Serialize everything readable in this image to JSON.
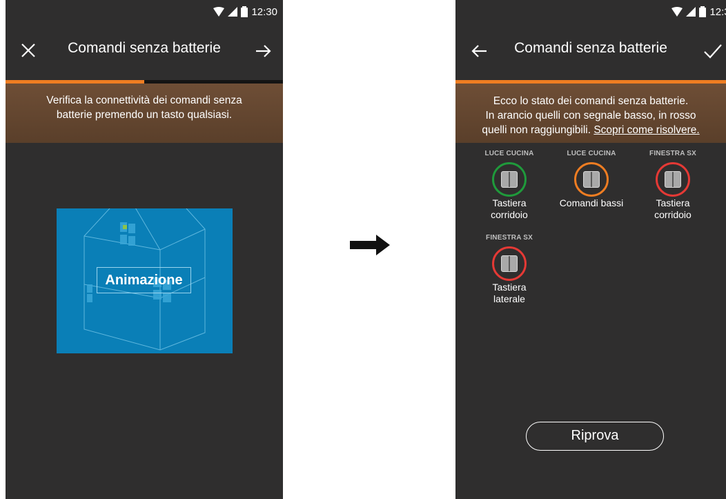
{
  "status_bar": {
    "time": "12:30"
  },
  "left_screen": {
    "title": "Comandi senza batterie",
    "progress_fraction": 0.5,
    "banner_lines": [
      "Verifica la connettività dei comandi senza",
      "batterie premendo un tasto qualsiasi."
    ],
    "animation_label": "Animazione",
    "icons": {
      "left": "close-icon",
      "right": "arrow-right-icon"
    }
  },
  "right_screen": {
    "title": "Comandi senza batterie",
    "banner_lines": [
      "Ecco lo stato dei comandi senza batterie.",
      "In arancio quelli con segnale basso, in rosso"
    ],
    "banner_last_prefix": "quelli non raggiungibili. ",
    "banner_link": "Scopri come risolvere.",
    "devices": [
      {
        "caption": "LUCE CUCINA",
        "name_line1": "Tastiera",
        "name_line2": "corridoio",
        "status_color": "#1f9a3b"
      },
      {
        "caption": "LUCE CUCINA",
        "name_line1": "Comandi bassi",
        "name_line2": "",
        "status_color": "#ef7d22"
      },
      {
        "caption": "FINESTRA SX",
        "name_line1": "Tastiera",
        "name_line2": "corridoio",
        "status_color": "#e53935"
      },
      {
        "caption": "FINESTRA SX",
        "name_line1": "Tastiera",
        "name_line2": "laterale",
        "status_color": "#e53935"
      }
    ],
    "retry_label": "Riprova",
    "icons": {
      "left": "arrow-left-icon",
      "right": "check-icon"
    }
  },
  "colors": {
    "screen_background": "#2f2e2e",
    "accent_orange": "#ef7d22",
    "banner_brown": "#6e4e36",
    "animation_blue": "#0a7fb7"
  }
}
